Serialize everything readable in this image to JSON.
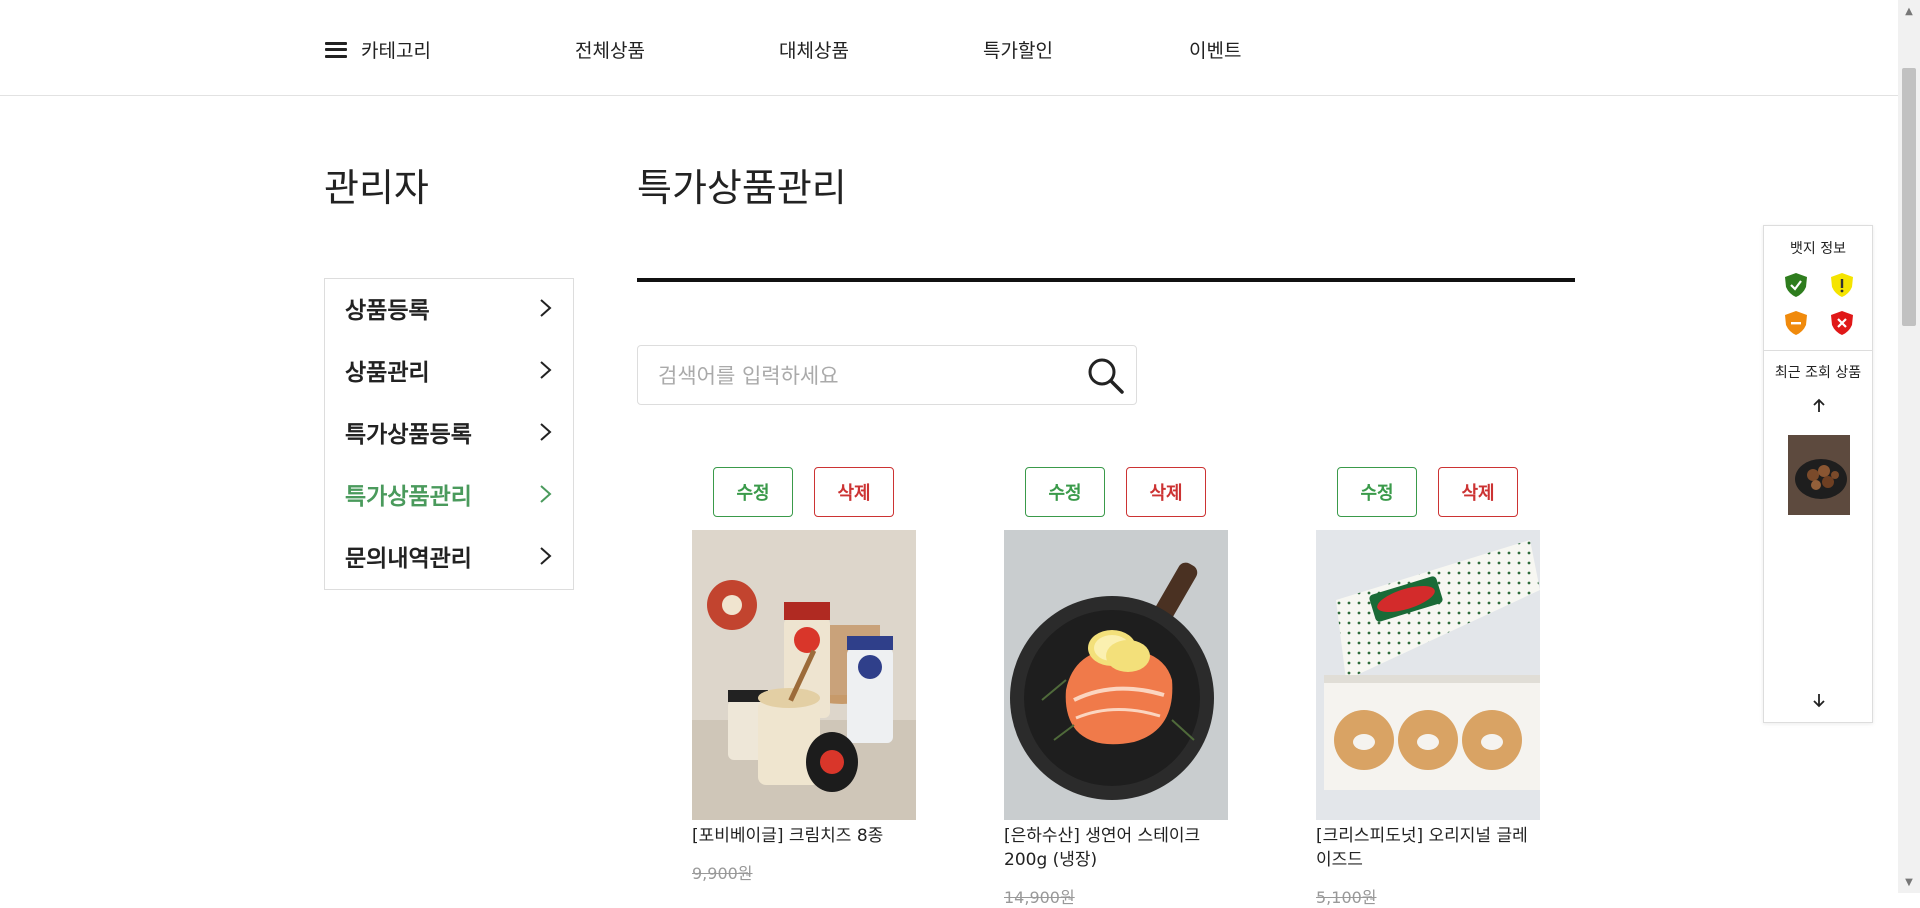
{
  "nav": {
    "category_label": "카테고리",
    "items": [
      "전체상품",
      "대체상품",
      "특가할인",
      "이벤트"
    ]
  },
  "admin_title": "관리자",
  "page_title": "특가상품관리",
  "sidebar": {
    "items": [
      {
        "label": "상품등록"
      },
      {
        "label": "상품관리"
      },
      {
        "label": "특가상품등록"
      },
      {
        "label": "특가상품관리"
      },
      {
        "label": "문의내역관리"
      }
    ],
    "active_color": "#4a9a5c"
  },
  "search": {
    "placeholder": "검색어를 입력하세요",
    "value": ""
  },
  "buttons": {
    "edit_label": "수정",
    "delete_label": "삭제"
  },
  "products": [
    {
      "name": "[포비베이글] 크림치즈 8종",
      "price": "9,900원",
      "image": "cream-cheese-jars"
    },
    {
      "name": "[은하수산] 생연어 스테이크 200g (냉장)",
      "price": "14,900원",
      "image": "salmon-steak-pan"
    },
    {
      "name": "[크리스피도넛] 오리지널 글레이즈드",
      "price": "5,100원",
      "image": "glazed-donuts-box"
    }
  ],
  "float_panel": {
    "badge_title": "뱃지 정보",
    "badges": [
      {
        "icon": "shield-check-icon",
        "color": "#2e7d1e"
      },
      {
        "icon": "shield-exclamation-icon",
        "color": "#f5e400"
      },
      {
        "icon": "shield-minus-icon",
        "color": "#f08a0c"
      },
      {
        "icon": "shield-x-icon",
        "color": "#e01818"
      }
    ],
    "recent_title": "최근 조회 상품"
  }
}
